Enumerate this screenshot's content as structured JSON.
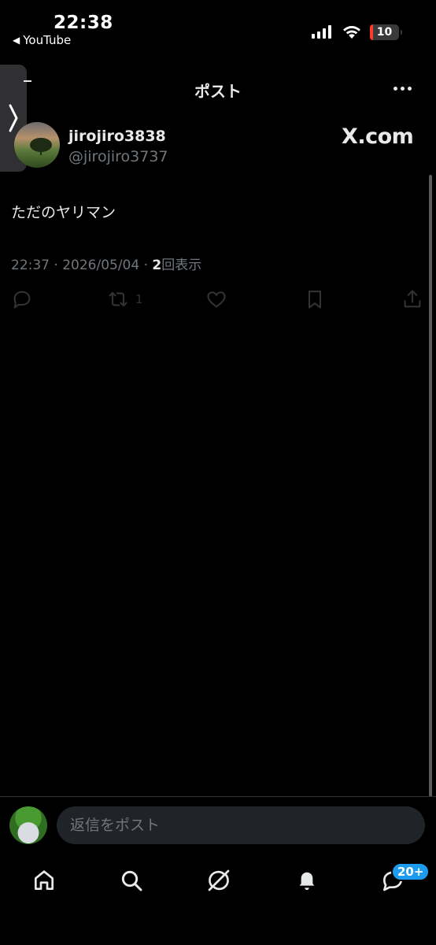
{
  "status_bar": {
    "time": "22:38",
    "back_app": "YouTube",
    "battery_level": "10",
    "signal_bars": 4
  },
  "header": {
    "title": "ポスト"
  },
  "post": {
    "display_name": "jirojiro3838",
    "handle": "@jirojiro3737",
    "watermark": "X.com",
    "text": "ただのヤリマン",
    "timestamp": "22:37 · 2026/05/04 · ",
    "views_count": "2",
    "views_label": "回表示",
    "actions": {
      "reply_icon": "reply-icon",
      "repost_icon": "repost-icon",
      "repost_count": "1",
      "like_icon": "heart-icon",
      "bookmark_icon": "bookmark-icon",
      "share_icon": "share-icon"
    }
  },
  "reply": {
    "placeholder": "返信をポスト"
  },
  "nav": {
    "items": [
      "home-icon",
      "search-icon",
      "grok-icon",
      "notifications-icon",
      "messages-icon"
    ],
    "messages_badge": "20+"
  },
  "colors": {
    "background": "#000000",
    "text_primary": "#e7e9ea",
    "text_secondary": "#71767b",
    "accent": "#1d9bf0",
    "battery_low": "#ff3b30"
  }
}
